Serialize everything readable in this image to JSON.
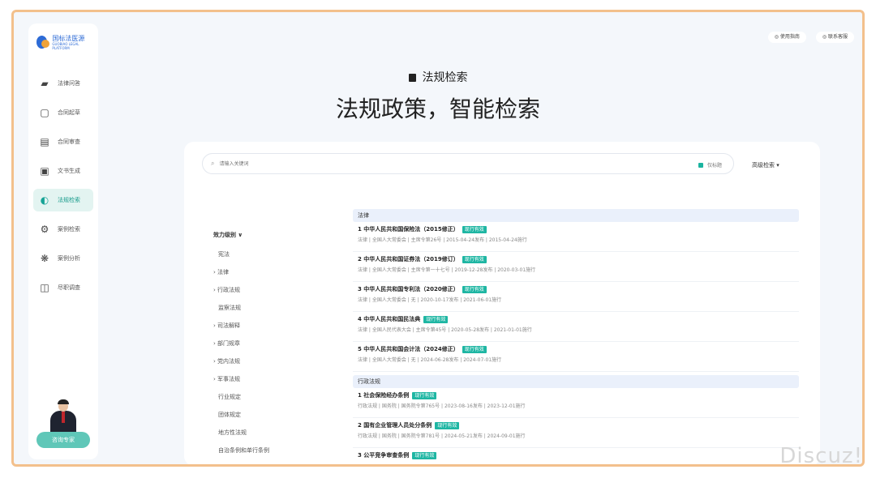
{
  "brand": {
    "line1": "国标法医源",
    "line2": "GUOBIAO LEGAL PLATFORM"
  },
  "nav": {
    "items": [
      {
        "label": "法律问答",
        "icon": "chat-bubble-icon"
      },
      {
        "label": "合同起草",
        "icon": "contract-draft-icon"
      },
      {
        "label": "合同审查",
        "icon": "contract-review-icon"
      },
      {
        "label": "文书生成",
        "icon": "document-generate-icon"
      },
      {
        "label": "法规检索",
        "icon": "regulation-search-icon"
      },
      {
        "label": "案例检索",
        "icon": "case-search-icon"
      },
      {
        "label": "案例分析",
        "icon": "case-analysis-icon"
      },
      {
        "label": "尽职调查",
        "icon": "due-diligence-icon"
      }
    ],
    "active_index": 4
  },
  "expert": {
    "button": "咨询专家"
  },
  "top_buttons": {
    "left": "◎ 使用指南",
    "right": "◎ 联系客服"
  },
  "hero": {
    "subtitle": "法规检索",
    "title": "法规政策，智能检索"
  },
  "search": {
    "placeholder": "请输入关键词",
    "toggle_label": "仅标题",
    "advanced": "高级检索 ▾"
  },
  "tree": {
    "header": "效力级别 ∨",
    "items": [
      "宪法",
      "法律",
      "行政法规",
      "监察法规",
      "司法解释",
      "部门规章",
      "党内法规",
      "军事法规",
      "行业规定",
      "团体规定",
      "地方性法规",
      "自治条例和单行条例"
    ]
  },
  "sections": [
    {
      "title": "法律",
      "results": [
        {
          "title": "1  中华人民共和国保险法（2015修正）",
          "badge": "现行有效",
          "meta": "法律 | 全国人大常委会 | 主席令第26号 | 2015-04-24发布 | 2015-04-24施行"
        },
        {
          "title": "2  中华人民共和国证券法（2019修订）",
          "badge": "现行有效",
          "meta": "法律 | 全国人大常委会 | 主席令第一十七号 | 2019-12-28发布 | 2020-03-01施行"
        },
        {
          "title": "3  中华人民共和国专利法（2020修正）",
          "badge": "现行有效",
          "meta": "法律 | 全国人大常委会 | 无 | 2020-10-17发布 | 2021-06-01施行"
        },
        {
          "title": "4  中华人民共和国民法典",
          "badge": "现行有效",
          "meta": "法律 | 全国人民代表大会 | 主席令第45号 | 2020-05-28发布 | 2021-01-01施行"
        },
        {
          "title": "5  中华人民共和国会计法（2024修正）",
          "badge": "现行有效",
          "meta": "法律 | 全国人大常委会 | 无 | 2024-06-28发布 | 2024-07-01施行"
        }
      ]
    },
    {
      "title": "行政法规",
      "results": [
        {
          "title": "1  社会保险经办条例",
          "badge": "现行有效",
          "meta": "行政法规 | 国务院 | 国务院令第765号 | 2023-08-16发布 | 2023-12-01施行"
        },
        {
          "title": "2  国有企业管理人员处分条例",
          "badge": "现行有效",
          "meta": "行政法规 | 国务院 | 国务院令第781号 | 2024-05-21发布 | 2024-09-01施行"
        },
        {
          "title": "3  公平竞争审查条例",
          "badge": "现行有效",
          "meta": ""
        }
      ]
    }
  ],
  "watermark": "Discuz!",
  "colors": {
    "accent": "#1eb6a3",
    "frame": "#f3c08c",
    "active_bg": "#e3f4f1"
  }
}
